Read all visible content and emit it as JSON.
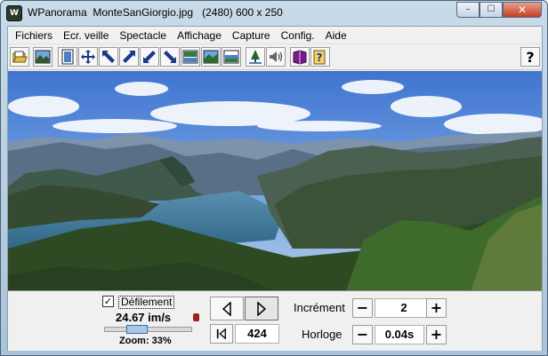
{
  "window": {
    "title": "WPanorama  MonteSanGiorgio.jpg   (2480) 600 x 250",
    "app_icon_text": "W",
    "controls": {
      "minimize": "–",
      "maximize": "☐",
      "close": "✕"
    }
  },
  "menu": [
    {
      "label": "Fichiers"
    },
    {
      "label": "Ecr. veille"
    },
    {
      "label": "Spectacle"
    },
    {
      "label": "Affichage"
    },
    {
      "label": "Capture"
    },
    {
      "label": "Config."
    },
    {
      "label": "Aide"
    }
  ],
  "toolbar": {
    "icons": [
      "open-file-icon",
      "picture-icon",
      "frame-icon",
      "move-icon",
      "arrow-up-left-icon",
      "arrow-up-right-icon",
      "arrow-down-left-icon",
      "arrow-down-right-icon",
      "view-top-icon",
      "view-full-icon",
      "view-bottom-icon",
      "tree-icon",
      "sound-icon",
      "book-icon",
      "info-icon"
    ],
    "help_label": "?"
  },
  "panorama": {
    "image_name": "MonteSanGiorgio.jpg",
    "colors": {
      "sky": "#6a9be0",
      "lake": "#3d7a9c",
      "mountains": "#3f5a4a",
      "forest": "#2d4a22"
    }
  },
  "controls": {
    "scroll_checkbox_checked": true,
    "scroll_checkmark": "✓",
    "scroll_label": "Défilement",
    "speed": "24.67 im/s",
    "zoom": "Zoom: 33%",
    "zoom_level": 0.33,
    "frame_counter": "424",
    "increment_label": "Incrément",
    "increment_value": "2",
    "clock_label": "Horloge",
    "clock_value": "0.04s",
    "minus": "−",
    "plus": "+"
  }
}
